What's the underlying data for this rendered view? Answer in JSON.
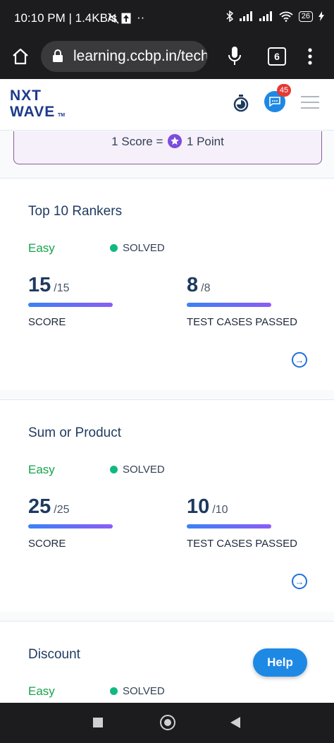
{
  "status_bar": {
    "time": "10:10 PM | 1.4KB/s",
    "icons": [
      "mute-icon",
      "upload-icon",
      "more-dots-icon",
      "bluetooth-icon",
      "signal-icon",
      "signal-icon",
      "wifi-icon",
      "battery-icon"
    ],
    "battery": "26",
    "more": "··"
  },
  "browser": {
    "url": "learning.ccbp.in/tech",
    "tab_count": "6"
  },
  "header": {
    "logo_line1": "NXT",
    "logo_line2": "WAVE",
    "logo_tm": "TM",
    "notification_count": "45"
  },
  "banner": {
    "left": "1 Score =",
    "right": "1 Point"
  },
  "problems": [
    {
      "title": "Top 10 Rankers",
      "difficulty": "Easy",
      "status": "SOLVED",
      "score": "15",
      "score_total": "/15",
      "score_label": "SCORE",
      "tests": "8",
      "tests_total": "/8",
      "tests_label": "TEST CASES PASSED",
      "score_fraction": 1.0,
      "tests_fraction": 1.0
    },
    {
      "title": "Sum or Product",
      "difficulty": "Easy",
      "status": "SOLVED",
      "score": "25",
      "score_total": "/25",
      "score_label": "SCORE",
      "tests": "10",
      "tests_total": "/10",
      "tests_label": "TEST CASES PASSED",
      "score_fraction": 1.0,
      "tests_fraction": 1.0
    },
    {
      "title": "Discount",
      "difficulty": "Easy",
      "status": "SOLVED"
    }
  ],
  "help_label": "Help",
  "colors": {
    "accent_blue": "#1e88e5",
    "solved_green": "#10b981",
    "easy_green": "#16a34a",
    "notification_red": "#e53935",
    "bar_gradient_start": "#3b82f6",
    "bar_gradient_end": "#8b5cf6"
  }
}
